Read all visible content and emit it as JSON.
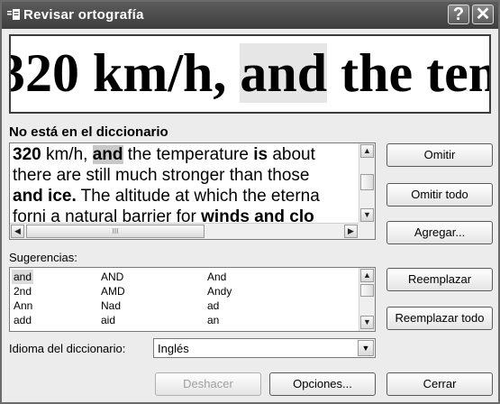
{
  "window": {
    "title": "Revisar ortografía",
    "help_label": "?",
    "close_label": "✕"
  },
  "preview": {
    "before": "320 km/h, ",
    "highlight": "and",
    "after": " the temperature"
  },
  "not_in_dictionary": {
    "label": "No está en el diccionario",
    "lines": [
      {
        "a": "320",
        "b": " km/h, ",
        "c": "and",
        "d": " the temperature ",
        "e": "is",
        "f": " about"
      },
      {
        "text": "there are still much stronger than those"
      },
      {
        "bold": "and ice.",
        "rest": " The altitude at which the eterna"
      },
      {
        "text": "forni a natural barrier for ",
        "bold": "winds and clo"
      }
    ],
    "hscroll_grip": "III"
  },
  "suggestions": {
    "label": "Sugerencias:",
    "rows": [
      [
        "and",
        "AND",
        "And"
      ],
      [
        "2nd",
        "AMD",
        "Andy"
      ],
      [
        "Ann",
        "Nad",
        "ad"
      ],
      [
        "add",
        "aid",
        "an"
      ]
    ]
  },
  "buttons": {
    "omit": "Omitir",
    "omit_all": "Omitir todo",
    "add": "Agregar...",
    "replace": "Reemplazar",
    "replace_all": "Reemplazar todo",
    "undo": "Deshacer",
    "options": "Opciones...",
    "close": "Cerrar"
  },
  "dictionary_language": {
    "label": "Idioma del diccionario:",
    "value": "Inglés"
  },
  "icons": {
    "up": "▲",
    "down": "▼",
    "left": "◀",
    "right": "▶"
  }
}
